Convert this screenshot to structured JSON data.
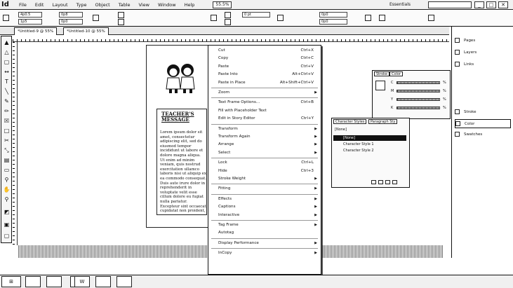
{
  "menubar": {
    "app_logo": "Id",
    "items": [
      "File",
      "Edit",
      "Layout",
      "Type",
      "Object",
      "Table",
      "View",
      "Window",
      "Help"
    ],
    "zoom": "55.5%",
    "workspace": "Essentials",
    "window_buttons": [
      "_",
      "□",
      "✕"
    ]
  },
  "controlbar": {
    "x": "4p0.5",
    "y": "1p5",
    "w": "0p8",
    "h": "0p0",
    "stroke_weight": "0 pt",
    "offset": "0p0"
  },
  "tabs": [
    "*Untitled-9 @ 55%",
    "*Untitled-10 @ 55%"
  ],
  "page": {
    "title": "TEACHER'S MESSAGE",
    "body": "Lorem ipsum dolor sit amet, consectetur adipiscing elit, sed do eiusmod tempor incididunt ut labore et dolore magna aliqua. Ut enim ad minim veniam, quis nostrud exercitation ullamco laboris nisi ut aliquip ex ea commodo consequat. Duis aute irure dolor in reprehenderit in voluptate velit esse cillum dolore eu fugiat nulla pariatur. Excepteur sint occaecat cupidatat non proident, sunt in culpa qui officia."
  },
  "context_menu": [
    {
      "label": "Cut",
      "shortcut": "Ctrl+X"
    },
    {
      "label": "Copy",
      "shortcut": "Ctrl+C"
    },
    {
      "label": "Paste",
      "shortcut": "Ctrl+V"
    },
    {
      "label": "Paste Into",
      "shortcut": "Alt+Ctrl+V"
    },
    {
      "label": "Paste in Place",
      "shortcut": "Alt+Shift+Ctrl+V"
    },
    {
      "sep": true
    },
    {
      "label": "Zoom",
      "submenu": true
    },
    {
      "sep": true
    },
    {
      "label": "Text Frame Options...",
      "shortcut": "Ctrl+B"
    },
    {
      "label": "Fill with Placeholder Text"
    },
    {
      "label": "Edit in Story Editor",
      "shortcut": "Ctrl+Y"
    },
    {
      "sep": true
    },
    {
      "label": "Transform",
      "submenu": true
    },
    {
      "label": "Transform Again",
      "submenu": true
    },
    {
      "label": "Arrange",
      "submenu": true
    },
    {
      "label": "Select",
      "submenu": true
    },
    {
      "sep": true
    },
    {
      "label": "Lock",
      "shortcut": "Ctrl+L"
    },
    {
      "label": "Hide",
      "shortcut": "Ctrl+3"
    },
    {
      "label": "Stroke Weight",
      "submenu": true
    },
    {
      "sep": true
    },
    {
      "label": "Fitting",
      "submenu": true
    },
    {
      "sep": true
    },
    {
      "label": "Effects",
      "submenu": true
    },
    {
      "label": "Captions",
      "submenu": true
    },
    {
      "label": "Interactive",
      "submenu": true
    },
    {
      "sep": true
    },
    {
      "label": "Tag Frame",
      "submenu": true
    },
    {
      "label": "Autotag"
    },
    {
      "sep": true
    },
    {
      "label": "Display Performance",
      "submenu": true
    },
    {
      "sep": true
    },
    {
      "label": "InCopy",
      "submenu": true
    }
  ],
  "swatch_panel": {
    "tabs": [
      "Stroke",
      "Color"
    ],
    "rows": [
      "C",
      "M",
      "Y",
      "K"
    ],
    "unit": "%"
  },
  "char_styles_panel": {
    "tabs": [
      "Character Styles",
      "Paragraph Sty"
    ],
    "header": "[None]",
    "styles": [
      "[None]",
      "Character Style 1",
      "Character Style 2"
    ]
  },
  "right_dock": [
    "Pages",
    "Layers",
    "Links",
    "Stroke",
    "Color",
    "Swatches"
  ],
  "taskbar": {
    "apps": [
      "",
      "",
      "",
      "W",
      "",
      ""
    ],
    "time": ""
  }
}
